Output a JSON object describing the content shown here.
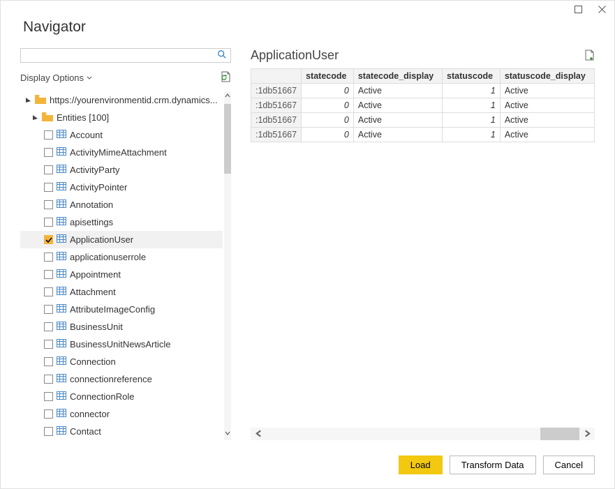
{
  "window_title": "Navigator",
  "search": {
    "placeholder": ""
  },
  "display_options_label": "Display Options",
  "tree": {
    "root_label": "https://yourenvironmentid.crm.dynamics...",
    "entities_label": "Entities [100]",
    "items": [
      {
        "label": "Account",
        "checked": false
      },
      {
        "label": "ActivityMimeAttachment",
        "checked": false
      },
      {
        "label": "ActivityParty",
        "checked": false
      },
      {
        "label": "ActivityPointer",
        "checked": false
      },
      {
        "label": "Annotation",
        "checked": false
      },
      {
        "label": "apisettings",
        "checked": false
      },
      {
        "label": "ApplicationUser",
        "checked": true
      },
      {
        "label": "applicationuserrole",
        "checked": false
      },
      {
        "label": "Appointment",
        "checked": false
      },
      {
        "label": "Attachment",
        "checked": false
      },
      {
        "label": "AttributeImageConfig",
        "checked": false
      },
      {
        "label": "BusinessUnit",
        "checked": false
      },
      {
        "label": "BusinessUnitNewsArticle",
        "checked": false
      },
      {
        "label": "Connection",
        "checked": false
      },
      {
        "label": "connectionreference",
        "checked": false
      },
      {
        "label": "ConnectionRole",
        "checked": false
      },
      {
        "label": "connector",
        "checked": false
      },
      {
        "label": "Contact",
        "checked": false
      }
    ]
  },
  "preview": {
    "title": "ApplicationUser",
    "columns": [
      "",
      "statecode",
      "statecode_display",
      "statuscode",
      "statuscode_display"
    ],
    "rows": [
      {
        "id": ":1db51667",
        "statecode": "0",
        "statecode_display": "Active",
        "statuscode": "1",
        "statuscode_display": "Active"
      },
      {
        "id": ":1db51667",
        "statecode": "0",
        "statecode_display": "Active",
        "statuscode": "1",
        "statuscode_display": "Active"
      },
      {
        "id": ":1db51667",
        "statecode": "0",
        "statecode_display": "Active",
        "statuscode": "1",
        "statuscode_display": "Active"
      },
      {
        "id": ":1db51667",
        "statecode": "0",
        "statecode_display": "Active",
        "statuscode": "1",
        "statuscode_display": "Active"
      }
    ]
  },
  "buttons": {
    "load": "Load",
    "transform": "Transform Data",
    "cancel": "Cancel"
  }
}
